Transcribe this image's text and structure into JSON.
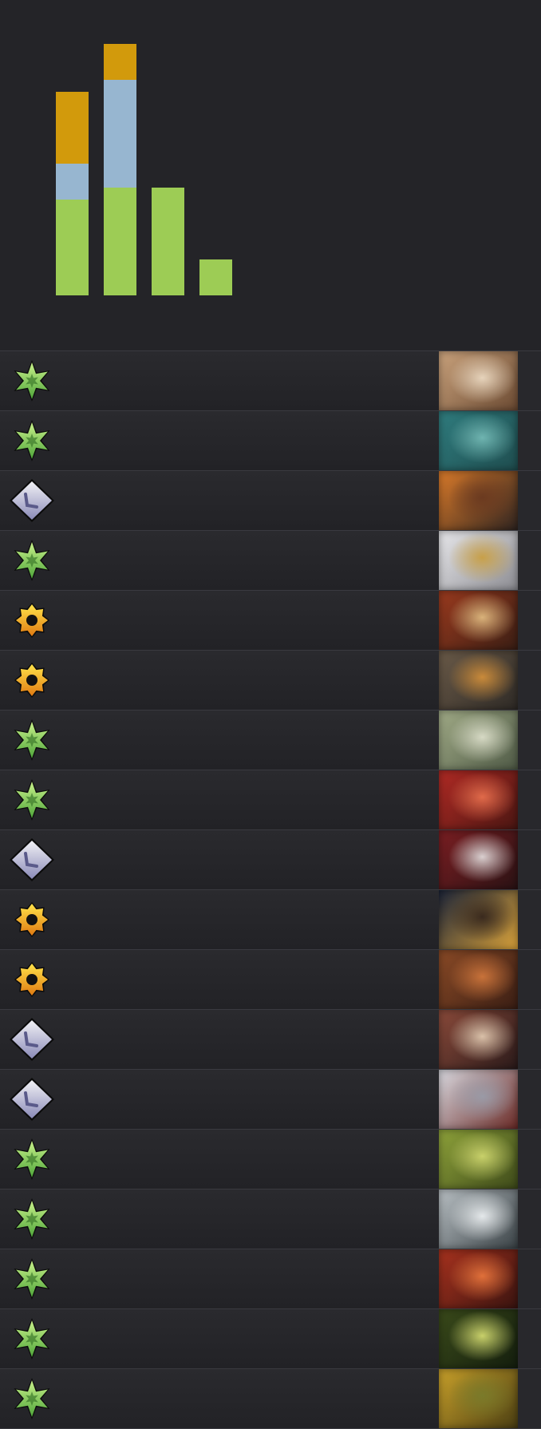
{
  "chart_data": {
    "type": "bar",
    "stacked": true,
    "categories": [
      "",
      "",
      "",
      ""
    ],
    "series": [
      {
        "color": "#9dcc55",
        "values": [
          8,
          9,
          9,
          3
        ]
      },
      {
        "color": "#97b6d0",
        "values": [
          3,
          9,
          0,
          0
        ]
      },
      {
        "color": "#d29a0c",
        "values": [
          6,
          3,
          0,
          0
        ]
      }
    ],
    "ylim": [
      0,
      24
    ],
    "grid": false,
    "legend": "none"
  },
  "cards": [
    {
      "rarity": "green-star-icon",
      "art": [
        "#c9a27c",
        "#6b4a32",
        "#e6d3bb"
      ]
    },
    {
      "rarity": "green-star-icon",
      "art": [
        "#2f7c7e",
        "#1f4d4f",
        "#6fb4b0"
      ]
    },
    {
      "rarity": "silver-diamond-icon",
      "art": [
        "#d97a2a",
        "#2f2420",
        "#6b3a20"
      ]
    },
    {
      "rarity": "green-star-icon",
      "art": [
        "#e7e7ea",
        "#8c8c92",
        "#c8a049"
      ]
    },
    {
      "rarity": "gold-gear-icon",
      "art": [
        "#9a3a1e",
        "#3a1e14",
        "#d9b27a"
      ]
    },
    {
      "rarity": "gold-gear-icon",
      "art": [
        "#6a5a48",
        "#2e2a26",
        "#c98a3a"
      ]
    },
    {
      "rarity": "green-star-icon",
      "art": [
        "#a0aa86",
        "#4f5a46",
        "#d6d9c4"
      ]
    },
    {
      "rarity": "green-star-icon",
      "art": [
        "#b02a24",
        "#4a1612",
        "#e06a4a"
      ]
    },
    {
      "rarity": "silver-diamond-icon",
      "art": [
        "#7a1e22",
        "#2a1214",
        "#d9cfcf"
      ]
    },
    {
      "rarity": "gold-gear-icon",
      "art": [
        "#1c2438",
        "#d9a23a",
        "#3a2a1e"
      ]
    },
    {
      "rarity": "gold-gear-icon",
      "art": [
        "#8a4a26",
        "#3a1e14",
        "#c8723a"
      ]
    },
    {
      "rarity": "silver-diamond-icon",
      "art": [
        "#8a4a3a",
        "#2a1a1a",
        "#d9c0a8"
      ]
    },
    {
      "rarity": "silver-diamond-icon",
      "art": [
        "#d9d9e0",
        "#6a2a26",
        "#9a9aa6"
      ]
    },
    {
      "rarity": "green-star-icon",
      "art": [
        "#8ea23a",
        "#3e4a1a",
        "#c8d06a"
      ]
    },
    {
      "rarity": "green-star-icon",
      "art": [
        "#b9c0c4",
        "#3a4246",
        "#e4e8ea"
      ]
    },
    {
      "rarity": "green-star-icon",
      "art": [
        "#a8321e",
        "#3a1410",
        "#e0703a"
      ]
    },
    {
      "rarity": "green-star-icon",
      "art": [
        "#3a4a1a",
        "#141e0e",
        "#c8d06a"
      ]
    },
    {
      "rarity": "green-star-icon",
      "art": [
        "#c8a02a",
        "#4a3e12",
        "#7a7a2a"
      ]
    }
  ]
}
